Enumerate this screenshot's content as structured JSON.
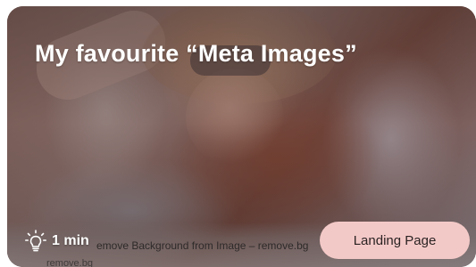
{
  "card": {
    "title": "My favourite “Meta Images”",
    "duration": "1 min",
    "duration_icon": "lightbulb-icon",
    "category": "Landing Page",
    "badge_color": "#f3c9c7",
    "preview": {
      "page_title": "emove Background from Image – remove.bg",
      "url": "remove.bg"
    }
  }
}
